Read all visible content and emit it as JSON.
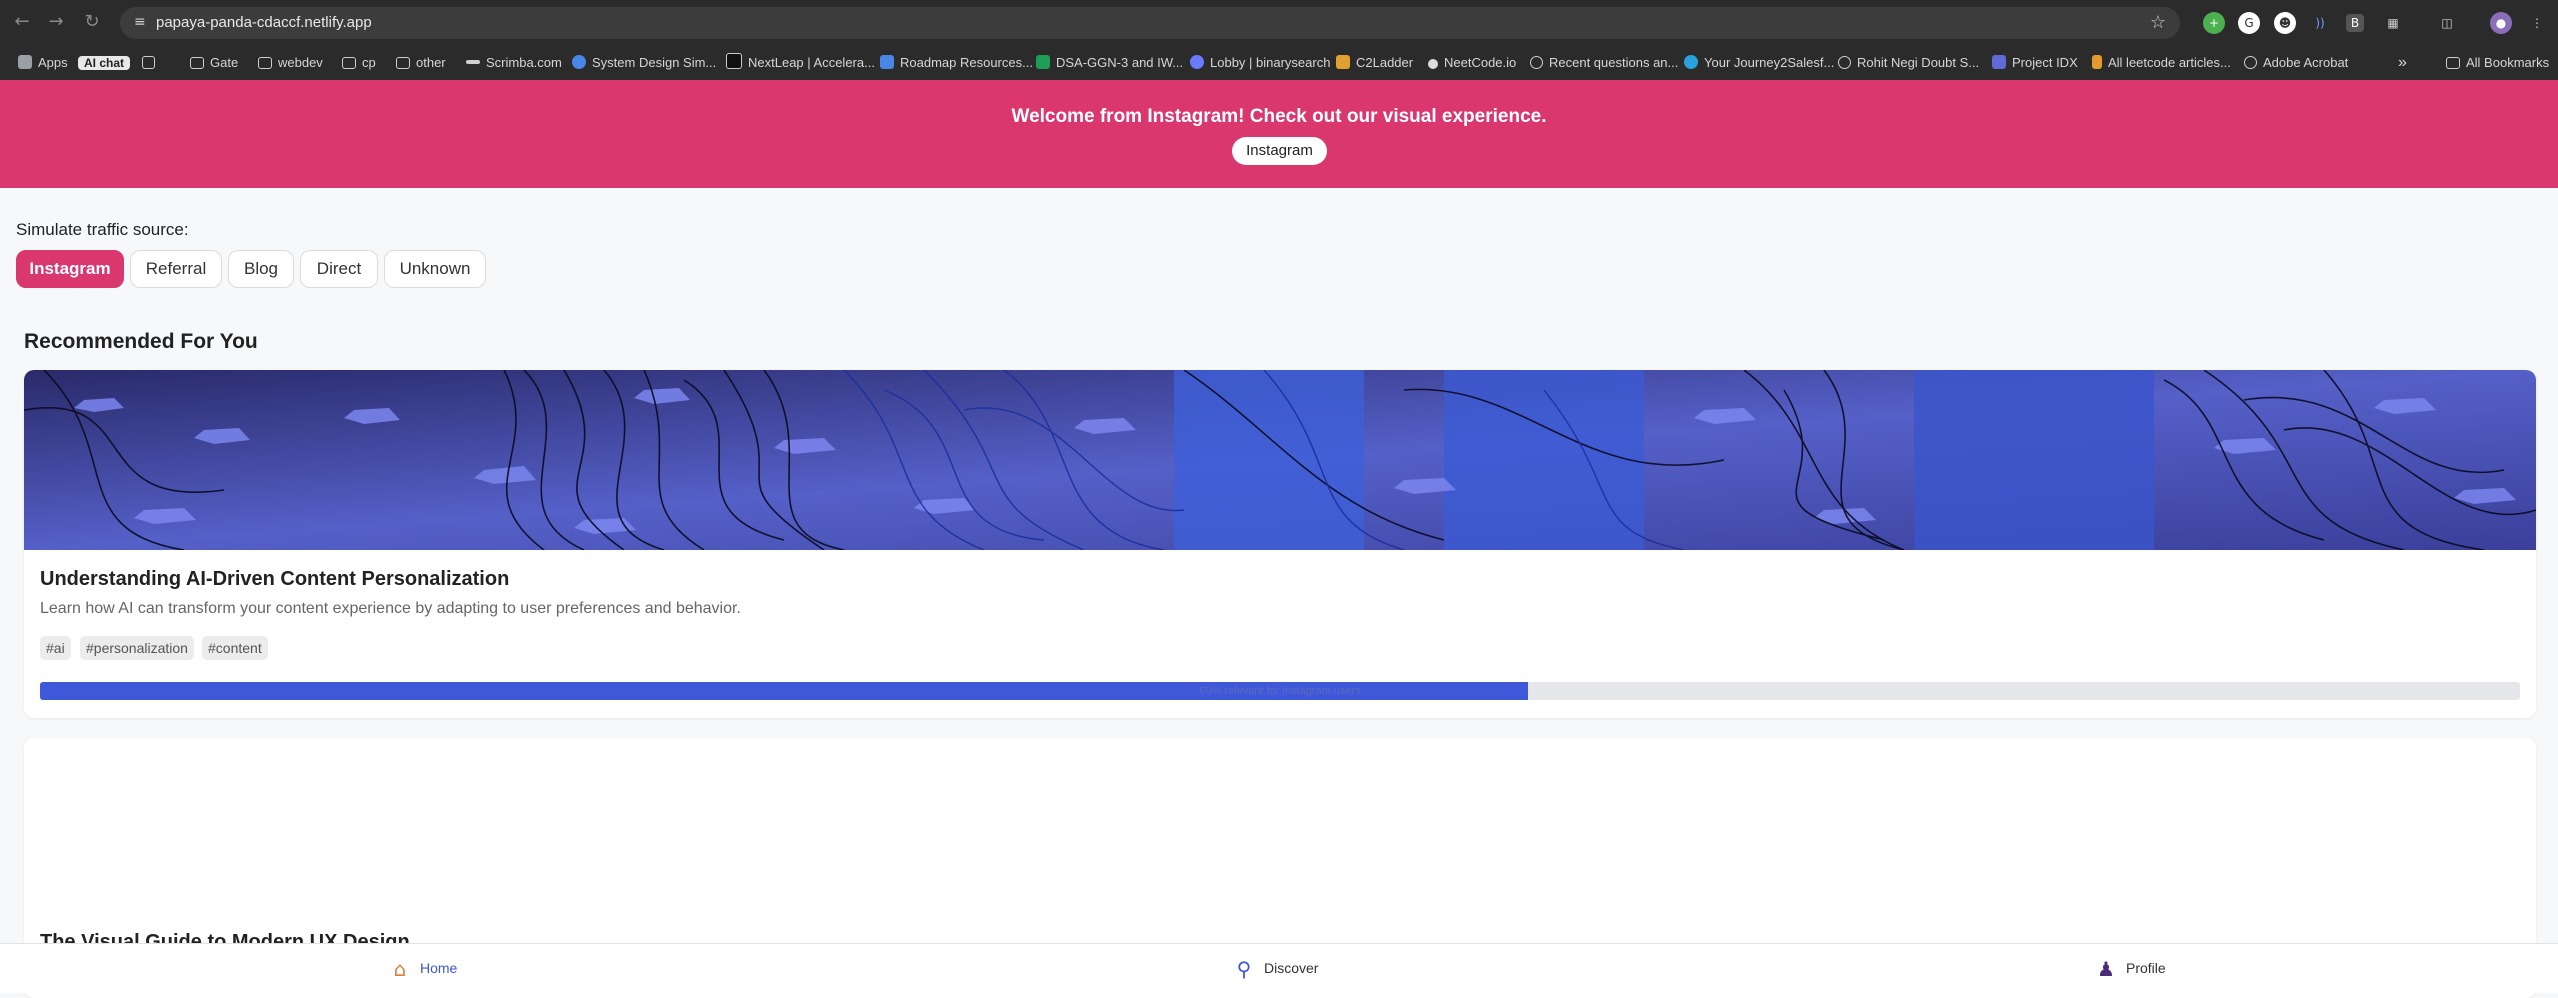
{
  "browser": {
    "url": "papaya-panda-cdaccf.netlify.app",
    "bookmarks": [
      {
        "label": "Apps",
        "icon": "apps-grid-icon"
      },
      {
        "label": "AI chat",
        "icon": "ai-chat-badge"
      },
      {
        "label": "",
        "icon": "tab-groups-icon"
      },
      {
        "label": "Gate",
        "icon": "folder-icon"
      },
      {
        "label": "webdev",
        "icon": "folder-icon"
      },
      {
        "label": "cp",
        "icon": "folder-icon"
      },
      {
        "label": "other",
        "icon": "folder-icon"
      },
      {
        "label": "Scrimba.com",
        "icon": "scrimba-icon"
      },
      {
        "label": "System Design Sim...",
        "icon": "system-design-icon"
      },
      {
        "label": "NextLeap | Accelera...",
        "icon": "nextleap-icon"
      },
      {
        "label": "Roadmap Resources...",
        "icon": "docs-icon"
      },
      {
        "label": "DSA-GGN-3 and IW...",
        "icon": "sheets-icon"
      },
      {
        "label": "Lobby | binarysearch",
        "icon": "binarysearch-icon"
      },
      {
        "label": "C2Ladder",
        "icon": "c2ladder-icon"
      },
      {
        "label": "NeetCode.io",
        "icon": "neetcode-icon"
      },
      {
        "label": "Recent questions an...",
        "icon": "globe-icon"
      },
      {
        "label": "Your Journey2Salesf...",
        "icon": "salesforce-icon"
      },
      {
        "label": "Rohit Negi Doubt S...",
        "icon": "globe-icon"
      },
      {
        "label": "Project IDX",
        "icon": "idx-icon"
      },
      {
        "label": "All leetcode articles...",
        "icon": "leetcode-icon"
      },
      {
        "label": "Adobe Acrobat",
        "icon": "globe-icon"
      }
    ],
    "bookmarks_more": "»",
    "all_bookmarks": "All Bookmarks"
  },
  "banner": {
    "title": "Welcome from Instagram! Check out our visual experience.",
    "button": "Instagram",
    "color": "#d9376e"
  },
  "simulate": {
    "label": "Simulate traffic source:",
    "options": [
      "Instagram",
      "Referral",
      "Blog",
      "Direct",
      "Unknown"
    ],
    "active": "Instagram"
  },
  "section_title": "Recommended For You",
  "cards": [
    {
      "title": "Understanding AI-Driven Content Personalization",
      "description": "Learn how AI can transform your content experience by adapting to user preferences and behavior.",
      "tags": [
        "#ai",
        "#personalization",
        "#content"
      ],
      "relevance_text": "60% relevant for instagram users",
      "relevance": 0.6
    },
    {
      "title": "The Visual Guide to Modern UX Design"
    }
  ],
  "bottom_nav": [
    {
      "label": "Home",
      "icon": "home-icon",
      "active": true
    },
    {
      "label": "Discover",
      "icon": "discover-search-icon",
      "active": false
    },
    {
      "label": "Profile",
      "icon": "profile-user-icon",
      "active": false
    }
  ],
  "colors": {
    "accent": "#3f57d9",
    "brand": "#d9376e"
  }
}
